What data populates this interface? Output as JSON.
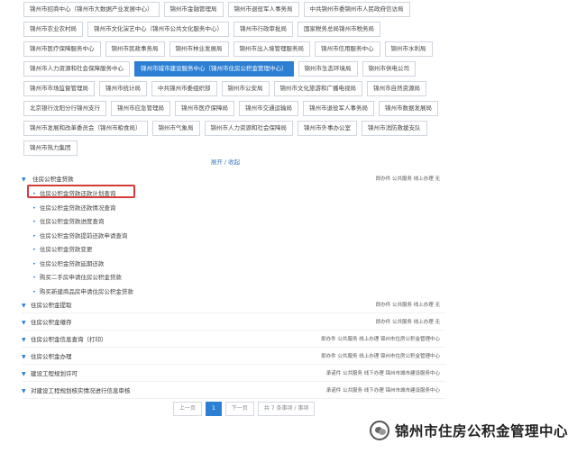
{
  "dept_tags": [
    [
      "锦州市招商中心（锦州市大数据产业发展中心）",
      "锦州市金融管理局",
      "锦州市退役军人事务局",
      "中共锦州市委锦州市人民政府信访局"
    ],
    [
      "锦州市农业农村局",
      "锦州市文化演艺中心（锦州市公共文化服务中心）",
      "锦州市行政审批局",
      "国家税务总局锦州市税务局"
    ],
    [
      "锦州市医疗保障服务中心",
      "锦州市民政事务局",
      "锦州市林业发展局",
      "锦州市出入境管理服务局",
      "锦州市信用服务中心",
      "锦州市水利局"
    ],
    [
      "锦州市人力资源和社会保障服务中心",
      "锦州市城市建设服务中心（锦州市住房公积金管理中心）",
      "锦州市生态环境局",
      "锦州市供电公司"
    ],
    [
      "锦州市市场监督管理局",
      "锦州市统计局",
      "中共锦州市委组织部",
      "锦州市公安局",
      "锦州市文化旅游和广播电视局",
      "锦州市自然资源局"
    ],
    [
      "北京银行沈阳分行锦州支行",
      "锦州市应急管理局",
      "锦州市医疗保障局",
      "锦州市交通运输局",
      "锦州市退役军人事务局",
      "锦州市数据发展局"
    ],
    [
      "锦州市发展和改革委员会（锦州市粮食局）",
      "锦州市气象局",
      "锦州市人力资源和社会保障局",
      "锦州市外事办公室",
      "锦州市消防救援支队"
    ],
    [
      "锦州市热力集团"
    ]
  ],
  "active_tag": "锦州市城市建设服务中心（锦州市住房公积金管理中心）",
  "toggle_label": "展开 / 收起",
  "expanded_group": {
    "title": "住房公积金贷款",
    "meta": "即办件  公共服务  线上办理  无",
    "items": [
      "住房公积金贷款还款计划查询",
      "住房公积金贷款还款情况查询",
      "住房公积金贷款进度查询",
      "住房公积金贷款提前还款申请查询",
      "住房公积金贷款变更",
      "住房公积金贷款延期还款",
      "购买二手房申请住房公积金贷款",
      "购买新建商品房申请住房公积金贷款"
    ]
  },
  "collapsed_groups": [
    {
      "title": "住房公积金提取",
      "meta": "即办件  公共服务  线上办理  无"
    },
    {
      "title": "住房公积金缴存",
      "meta": "即办件  公共服务  线上办理  无"
    },
    {
      "title": "住房公积金信息查询（打印）",
      "meta": "即办件  公共服务  线上办理  锦州市住房公积金管理中心"
    },
    {
      "title": "住房公积金办理",
      "meta": "即办件  公共服务  线上办理  锦州市住房公积金管理中心"
    },
    {
      "title": "建设工程规划许可",
      "meta": "承诺件  公共服务  线下办理  锦州市城市建设服务中心"
    },
    {
      "title": "对建设工程规划核实情况进行信息审核",
      "meta": "承诺件  公共服务  线下办理  锦州市城市建设服务中心"
    }
  ],
  "pager": {
    "prev": "上一页",
    "current": "1",
    "next": "下一页",
    "total": "共 7 条事项 / 事项"
  },
  "watermark": "锦州市住房公积金管理中心",
  "colors": {
    "accent": "#2d7fd3",
    "highlight": "#d63b3b"
  }
}
